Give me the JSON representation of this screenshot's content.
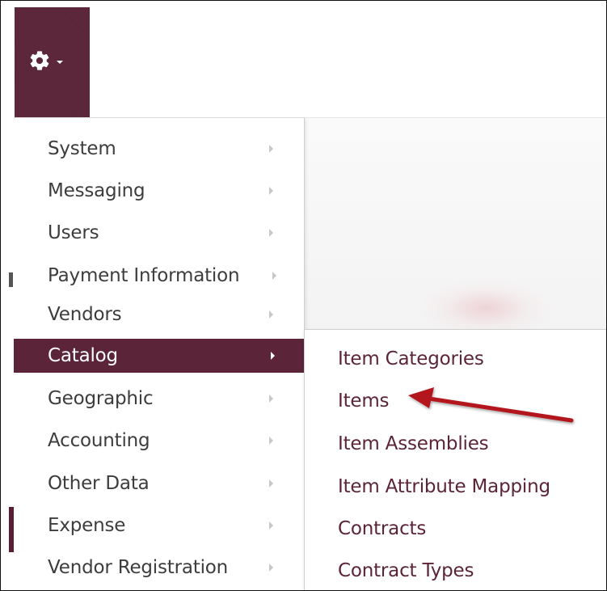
{
  "settings_button": {
    "icon": "gear-icon",
    "caret": "caret-down-icon"
  },
  "menu": {
    "items": [
      {
        "label": "System"
      },
      {
        "label": "Messaging"
      },
      {
        "label": "Users"
      },
      {
        "label": "Payment Information"
      },
      {
        "label": "Vendors"
      },
      {
        "label": "Catalog",
        "active": true
      },
      {
        "label": "Geographic"
      },
      {
        "label": "Accounting"
      },
      {
        "label": "Other Data"
      },
      {
        "label": "Expense"
      },
      {
        "label": "Vendor Registration"
      }
    ]
  },
  "submenu": {
    "items": [
      {
        "label": "Item Categories"
      },
      {
        "label": "Items"
      },
      {
        "label": "Item Assemblies"
      },
      {
        "label": "Item Attribute Mapping"
      },
      {
        "label": "Contracts"
      },
      {
        "label": "Contract Types"
      }
    ]
  },
  "colors": {
    "brand": "#5b2439",
    "menu_text": "#3d3d3d",
    "submenu_text": "#5b2439",
    "annotation_arrow": "#b3161e"
  },
  "annotation": {
    "icon": "red-arrow-icon",
    "points_to": "Items"
  }
}
